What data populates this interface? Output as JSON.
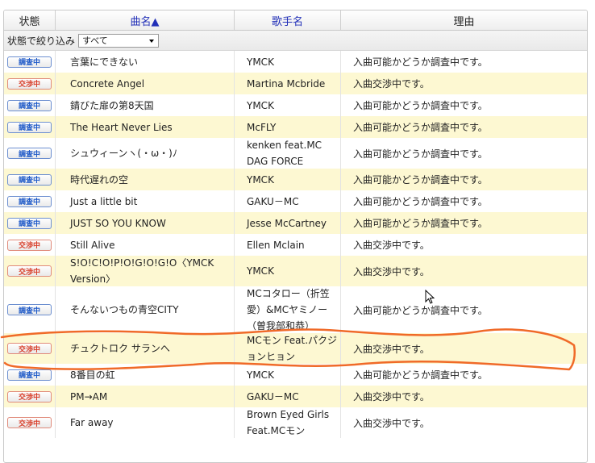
{
  "header": {
    "status": "状態",
    "song": "曲名▲",
    "artist": "歌手名",
    "reason": "理由"
  },
  "filter": {
    "label": "状態で絞り込み",
    "selected": "すべて"
  },
  "colors": {
    "investigating": "#1f5ac8",
    "negotiating": "#d8402c",
    "row_alt": "#fdf8d2",
    "scribble": "#f06a28"
  },
  "rows": [
    {
      "status": "調査中",
      "type": "inv",
      "song": "言葉にできない",
      "artist": "YMCK",
      "reason": "入曲可能かどうか調査中です。"
    },
    {
      "status": "交渉中",
      "type": "neg",
      "song": "Concrete Angel",
      "artist": "Martina Mcbride",
      "reason": "入曲交渉中です。"
    },
    {
      "status": "調査中",
      "type": "inv",
      "song": "錆びた扉の第8天国",
      "artist": "YMCK",
      "reason": "入曲可能かどうか調査中です。"
    },
    {
      "status": "調査中",
      "type": "inv",
      "song": "The Heart Never Lies",
      "artist": "McFLY",
      "reason": "入曲可能かどうか調査中です。"
    },
    {
      "status": "調査中",
      "type": "inv",
      "song": "シュウィーンヽ(・ω・)ﾉ",
      "artist": "kenken feat.MC DAG FORCE",
      "reason": "入曲可能かどうか調査中です。"
    },
    {
      "status": "調査中",
      "type": "inv",
      "song": "時代遅れの空",
      "artist": "YMCK",
      "reason": "入曲可能かどうか調査中です。"
    },
    {
      "status": "調査中",
      "type": "inv",
      "song": "Just a little bit",
      "artist": "GAKU－MC",
      "reason": "入曲可能かどうか調査中です。"
    },
    {
      "status": "調査中",
      "type": "inv",
      "song": "JUST SO YOU KNOW",
      "artist": "Jesse McCartney",
      "reason": "入曲可能かどうか調査中です。"
    },
    {
      "status": "交渉中",
      "type": "neg",
      "song": "Still Alive",
      "artist": "Ellen Mclain",
      "reason": "入曲交渉中です。"
    },
    {
      "status": "交渉中",
      "type": "neg",
      "song": "S!O!C!O!P!O!G!O!G!O〈YMCK Version〉",
      "artist": "YMCK",
      "reason": "入曲交渉中です。"
    },
    {
      "status": "調査中",
      "type": "inv",
      "song": "そんないつもの青空CITY",
      "artist": "MCコタロー（折笠愛）&MCヤミノー（曽我部和恭）",
      "reason": "入曲可能かどうか調査中です。"
    },
    {
      "status": "交渉中",
      "type": "neg",
      "song": "チュクトロク サランへ",
      "artist": "MCモン Feat.パクジョンヒョン",
      "reason": "入曲交渉中です。"
    },
    {
      "status": "調査中",
      "type": "inv",
      "song": "8番目の虹",
      "artist": "YMCK",
      "reason": "入曲可能かどうか調査中です。"
    },
    {
      "status": "交渉中",
      "type": "neg",
      "song": "PM→AM",
      "artist": "GAKU－MC",
      "reason": "入曲交渉中です。"
    },
    {
      "status": "交渉中",
      "type": "neg",
      "song": "Far away",
      "artist": "Brown Eyed Girls Feat.MCモン",
      "reason": "入曲交渉中です。"
    }
  ]
}
